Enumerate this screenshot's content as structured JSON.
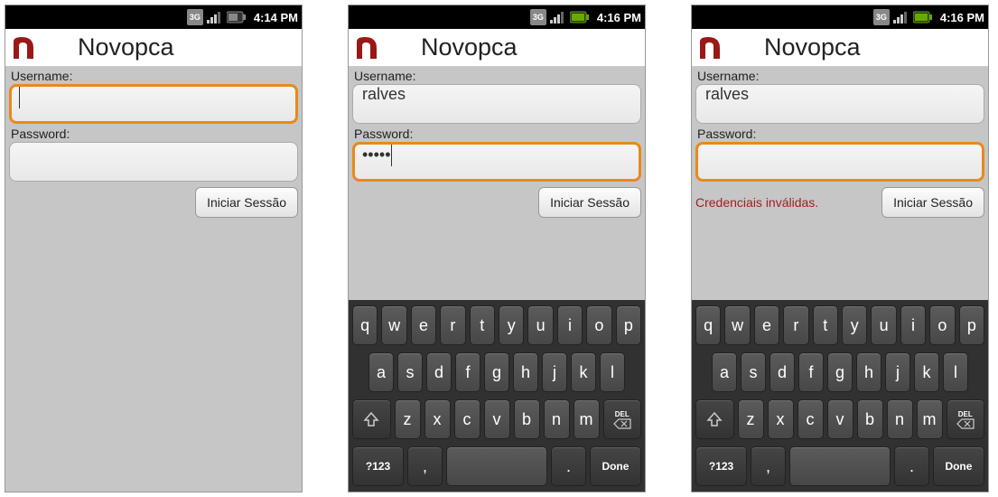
{
  "screens": [
    {
      "status": {
        "time": "4:14 PM",
        "network": "3G",
        "batteryColor": "#888"
      },
      "title": "Novopca",
      "usernameLabel": "Username:",
      "passwordLabel": "Password:",
      "usernameValue": "",
      "passwordValue": "",
      "usernameFocused": true,
      "passwordFocused": false,
      "errorText": "",
      "loginButton": "Iniciar Sessão",
      "showKeyboard": false
    },
    {
      "status": {
        "time": "4:16 PM",
        "network": "3G",
        "batteryColor": "#6a0"
      },
      "title": "Novopca",
      "usernameLabel": "Username:",
      "passwordLabel": "Password:",
      "usernameValue": "ralves",
      "passwordValue": "•••••",
      "usernameFocused": false,
      "passwordFocused": true,
      "errorText": "",
      "loginButton": "Iniciar Sessão",
      "showKeyboard": true
    },
    {
      "status": {
        "time": "4:16 PM",
        "network": "3G",
        "batteryColor": "#6a0"
      },
      "title": "Novopca",
      "usernameLabel": "Username:",
      "passwordLabel": "Password:",
      "usernameValue": "ralves",
      "passwordValue": "",
      "usernameFocused": false,
      "passwordFocused": true,
      "errorText": "Credenciais inválidas.",
      "loginButton": "Iniciar Sessão",
      "showKeyboard": true
    }
  ],
  "keyboard": {
    "row1": [
      "q",
      "w",
      "e",
      "r",
      "t",
      "y",
      "u",
      "i",
      "o",
      "p"
    ],
    "row2": [
      "a",
      "s",
      "d",
      "f",
      "g",
      "h",
      "j",
      "k",
      "l"
    ],
    "row3": [
      "z",
      "x",
      "c",
      "v",
      "b",
      "n",
      "m"
    ],
    "shift": "⇧",
    "del": "DEL",
    "symbols": "?123",
    "comma": ",",
    "period": ".",
    "done": "Done"
  }
}
